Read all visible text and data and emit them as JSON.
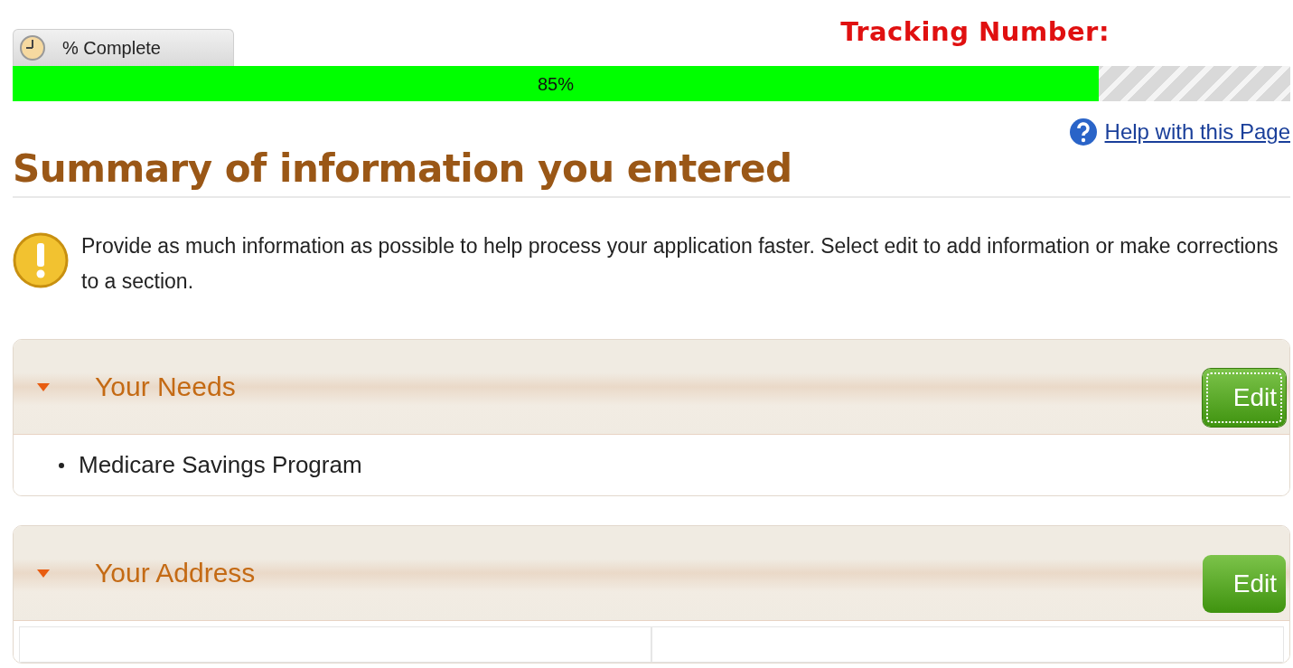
{
  "progress": {
    "tab_label": "% Complete",
    "level": 0.85,
    "reading": "85%"
  },
  "tracking": {
    "label": "Tracking Number:"
  },
  "help_link": "Help with this Page",
  "title": "Summary of information you entered",
  "notice": "Provide as much information as possible to help process your application faster. Select edit to add information or make corrections to a section.",
  "sections": [
    {
      "title": "Your Needs",
      "expanded": true,
      "edit": {
        "label": "Edit",
        "focused": true
      },
      "items": [
        "Medicare Savings Program"
      ],
      "kind": "list"
    },
    {
      "title": "Your Address",
      "expanded": true,
      "edit": {
        "label": "Edit",
        "focused": false
      },
      "kind": "grid"
    }
  ]
}
